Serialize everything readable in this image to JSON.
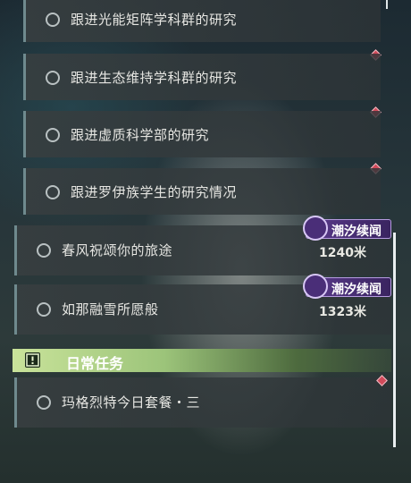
{
  "tasks": {
    "sub_items": [
      {
        "label": "跟进光能矩阵学科群的研究"
      },
      {
        "label": "跟进生态维持学科群的研究"
      },
      {
        "label": "跟进虚质科学部的研究"
      },
      {
        "label": "跟进罗伊族学生的研究情况"
      }
    ],
    "main_items": [
      {
        "label": "春风祝颂你的旅途",
        "distance": "1240米",
        "badge": "潮汐续闻"
      },
      {
        "label": "如那融雪所愿般",
        "distance": "1323米",
        "badge": "潮汐续闻"
      }
    ]
  },
  "daily": {
    "title": "日常任务",
    "items": [
      {
        "label": "玛格烈特今日套餐・三"
      }
    ]
  },
  "colors": {
    "badge": "#5a3b8c",
    "marker": "#d14a5a",
    "daily_header": "#b5d98c"
  }
}
